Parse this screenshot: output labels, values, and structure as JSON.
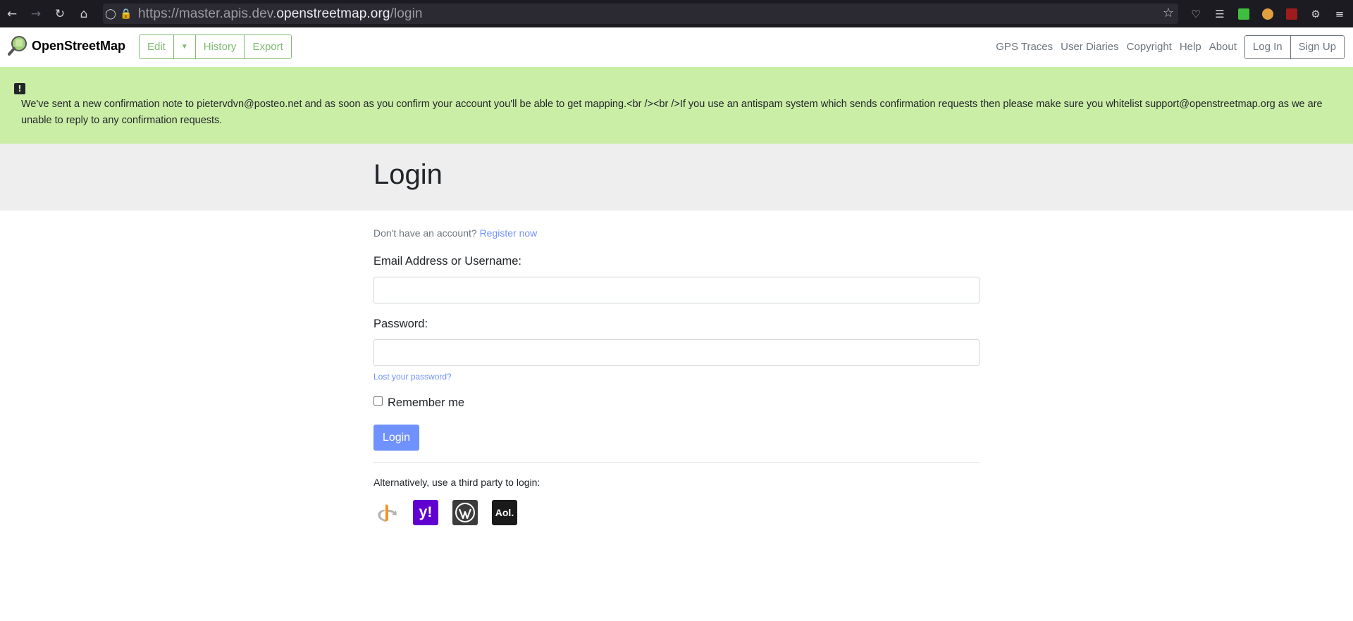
{
  "browser": {
    "url_prefix": "https://master.apis.dev.",
    "url_host": "openstreetmap.org",
    "url_path": "/login",
    "icons": [
      "back-icon",
      "forward-icon",
      "reload-icon",
      "home-icon",
      "shield-icon",
      "lock-icon",
      "star-icon",
      "pocket-icon",
      "library-icon",
      "extension-icon",
      "menu-icon"
    ]
  },
  "header": {
    "brand": "OpenStreetMap",
    "edit_label": "Edit",
    "history_label": "History",
    "export_label": "Export",
    "nav": [
      "GPS Traces",
      "User Diaries",
      "Copyright",
      "Help",
      "About"
    ],
    "login_label": "Log In",
    "signup_label": "Sign Up",
    "accent_color": "#7ebc6f"
  },
  "flash": {
    "icon": "exclamation-icon",
    "message": "We've sent a new confirmation note to pietervdvn@posteo.net and as soon as you confirm your account you'll be able to get mapping.<br /><br />If you use an antispam system which sends confirmation requests then please make sure you whitelist support@openstreetmap.org as we are unable to reply to any confirmation requests.",
    "background": "#cbeea7"
  },
  "page": {
    "title": "Login",
    "no_account_text": "Don't have an account?",
    "register_link": "Register now",
    "email_label": "Email Address or Username:",
    "email_value": "",
    "password_label": "Password:",
    "password_value": "",
    "lost_password": "Lost your password?",
    "remember_label": "Remember me",
    "login_button": "Login",
    "alt_login_text": "Alternatively, use a third party to login:",
    "providers": [
      {
        "name": "openid",
        "glyph": ""
      },
      {
        "name": "yahoo",
        "glyph": "y!"
      },
      {
        "name": "wordpress",
        "glyph": ""
      },
      {
        "name": "aol",
        "glyph": "Aol."
      }
    ],
    "button_color": "#7092ff"
  }
}
